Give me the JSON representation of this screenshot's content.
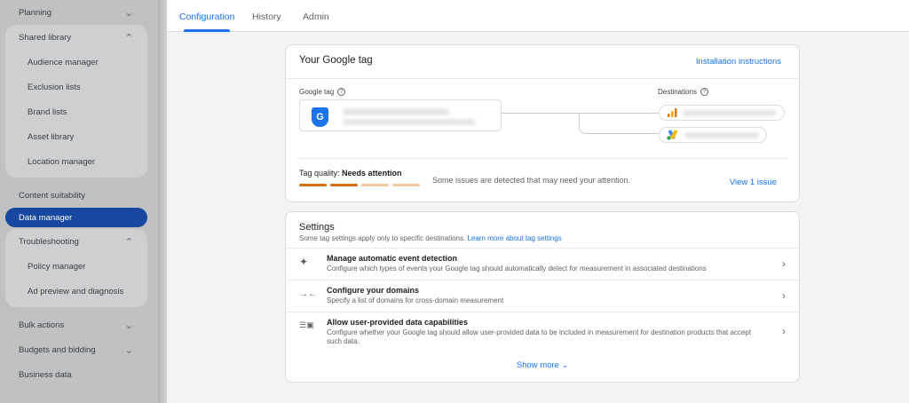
{
  "sidebar": {
    "planning": "Planning",
    "shared_library": {
      "label": "Shared library",
      "items": [
        "Audience manager",
        "Exclusion lists",
        "Brand lists",
        "Asset library",
        "Location manager"
      ]
    },
    "content_suitability": "Content suitability",
    "data_manager": "Data manager",
    "troubleshooting": {
      "label": "Troubleshooting",
      "items": [
        "Policy manager",
        "Ad preview and diagnosis"
      ]
    },
    "bulk_actions": "Bulk actions",
    "budgets_bidding": "Budgets and bidding",
    "business_data": "Business data"
  },
  "tabs": [
    "Configuration",
    "History",
    "Admin"
  ],
  "tag_card": {
    "title": "Your Google tag",
    "install_link": "Installation instructions",
    "google_tag_label": "Google tag",
    "tag_icon_letter": "G",
    "destinations_label": "Destinations",
    "quality_label": "Tag quality:",
    "quality_value": "Needs attention",
    "quality_message": "Some issues are detected that may need your attention.",
    "view_issue": "View 1 issue",
    "quality_colors": [
      "#d56e0c",
      "#d56e0c",
      "#f0c9a0",
      "#f0c9a0"
    ]
  },
  "settings": {
    "title": "Settings",
    "subtitle": "Some tag settings apply only to specific destinations.",
    "learn_more": "Learn more about tag settings",
    "rows": [
      {
        "title": "Manage automatic event detection",
        "desc": "Configure which types of events your Google tag should automatically detect for measurement in associated destinations",
        "icon": "sparkle-icon"
      },
      {
        "title": "Configure your domains",
        "desc": "Specify a list of domains for cross-domain measurement",
        "icon": "arrows-inward-icon"
      },
      {
        "title": "Allow user-provided data capabilities",
        "desc": "Configure whether your Google tag should allow user-provided data to be included in measurement for destination products that accept such data.",
        "icon": "user-data-icon"
      }
    ],
    "show_more": "Show more"
  },
  "colors": {
    "accent": "#1a73e8",
    "nav_active": "#17479e",
    "warning": "#d56e0c"
  }
}
